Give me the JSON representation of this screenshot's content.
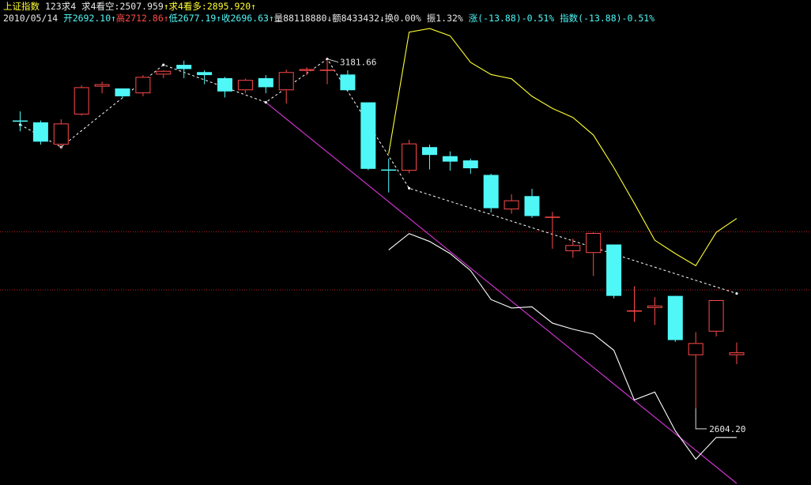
{
  "header": {
    "index_name": "上证指数",
    "mode": "123求4",
    "bear_label": "求4看空",
    "bear_value": "2507.959",
    "bull_label": "求4看多",
    "bull_value": "2895.920",
    "up_arrow": "↑",
    "down_arrow": "↓",
    "date": "2010/05/14",
    "open_label": "开",
    "open_value": "2692.10",
    "high_label": "高",
    "high_value": "2712.86",
    "low_label": "低",
    "low_value": "2677.19",
    "close_label": "收",
    "close_value": "2696.63",
    "volume_label": "量",
    "volume_value": "88118880",
    "amount_label": "额",
    "amount_value": "8433432",
    "turnover_label": "换",
    "turnover_value": "0.00%",
    "amplitude_label": "振",
    "amplitude_value": "1.32%",
    "change_label": "涨",
    "change_value": "(-13.88)-0.51%",
    "index_change_label": "指数",
    "index_change_value": "(-13.88)-0.51%"
  },
  "colors": {
    "background": "#000000",
    "up_candle": "#ff4a4a",
    "down_candle": "#4ff7f7",
    "upper_band": "#ffff33",
    "lower_band": "#ffffff",
    "trend_line": "#cc33cc",
    "zigzag": "#ffffff",
    "ref_line": "#b81e1e"
  },
  "chart_data": {
    "type": "candlestick",
    "annotations": [
      {
        "text": "3181.66",
        "kind": "peak",
        "value": 3181.66
      },
      {
        "text": "2604.20",
        "kind": "trough",
        "value": 2604.2
      }
    ],
    "reference_lines": [
      2895.92,
      2800.0
    ],
    "ylim": [
      2480,
      3240
    ],
    "candles": [
      {
        "o": 3080,
        "h": 3095,
        "l": 3062,
        "c": 3078
      },
      {
        "o": 3077,
        "h": 3080,
        "l": 3040,
        "c": 3045
      },
      {
        "o": 3040,
        "h": 3082,
        "l": 3033,
        "c": 3075
      },
      {
        "o": 3090,
        "h": 3138,
        "l": 3088,
        "c": 3135
      },
      {
        "o": 3136,
        "h": 3144,
        "l": 3125,
        "c": 3140
      },
      {
        "o": 3133,
        "h": 3133,
        "l": 3117,
        "c": 3120
      },
      {
        "o": 3125,
        "h": 3155,
        "l": 3120,
        "c": 3152
      },
      {
        "o": 3156,
        "h": 3163,
        "l": 3150,
        "c": 3162
      },
      {
        "o": 3172,
        "h": 3179,
        "l": 3150,
        "c": 3165
      },
      {
        "o": 3160,
        "h": 3163,
        "l": 3140,
        "c": 3155
      },
      {
        "o": 3150,
        "h": 3152,
        "l": 3118,
        "c": 3128
      },
      {
        "o": 3130,
        "h": 3149,
        "l": 3125,
        "c": 3147
      },
      {
        "o": 3150,
        "h": 3155,
        "l": 3125,
        "c": 3135
      },
      {
        "o": 3130,
        "h": 3164,
        "l": 3108,
        "c": 3160
      },
      {
        "o": 3162,
        "h": 3168,
        "l": 3155,
        "c": 3165
      },
      {
        "o": 3163,
        "h": 3181.66,
        "l": 3140,
        "c": 3164
      },
      {
        "o": 3156,
        "h": 3163,
        "l": 3128,
        "c": 3130
      },
      {
        "o": 3110,
        "h": 3110,
        "l": 2998,
        "c": 3000
      },
      {
        "o": 2999,
        "h": 3017,
        "l": 2961,
        "c": 2997
      },
      {
        "o": 2997,
        "h": 3048,
        "l": 2993,
        "c": 3042
      },
      {
        "o": 3036,
        "h": 3040,
        "l": 2999,
        "c": 3023
      },
      {
        "o": 3021,
        "h": 3029,
        "l": 2997,
        "c": 3012
      },
      {
        "o": 3014,
        "h": 3017,
        "l": 2992,
        "c": 3001
      },
      {
        "o": 2990,
        "h": 2992,
        "l": 2928,
        "c": 2935
      },
      {
        "o": 2933,
        "h": 2958,
        "l": 2926,
        "c": 2948
      },
      {
        "o": 2955,
        "h": 2967,
        "l": 2919,
        "c": 2922
      },
      {
        "o": 2920,
        "h": 2929,
        "l": 2868,
        "c": 2921
      },
      {
        "o": 2864,
        "h": 2885,
        "l": 2853,
        "c": 2874
      },
      {
        "o": 2861,
        "h": 2895,
        "l": 2823,
        "c": 2894
      },
      {
        "o": 2875,
        "h": 2875,
        "l": 2786,
        "c": 2790
      },
      {
        "o": 2765,
        "h": 2806,
        "l": 2747,
        "c": 2766
      },
      {
        "o": 2770,
        "h": 2788,
        "l": 2742,
        "c": 2774
      },
      {
        "o": 2790,
        "h": 2790,
        "l": 2714,
        "c": 2717
      },
      {
        "o": 2692,
        "h": 2730,
        "l": 2604.2,
        "c": 2712
      },
      {
        "o": 2731,
        "h": 2783,
        "l": 2723,
        "c": 2783
      },
      {
        "o": 2692.1,
        "h": 2712.86,
        "l": 2677.19,
        "c": 2696.63
      }
    ],
    "upper_band": [
      null,
      null,
      null,
      null,
      null,
      null,
      null,
      null,
      null,
      null,
      null,
      null,
      null,
      null,
      null,
      null,
      null,
      null,
      3025,
      3226,
      3232,
      3220,
      3176,
      3156,
      3149,
      3120,
      3100,
      3085,
      3056,
      3002,
      2943,
      2882,
      2860,
      2840,
      2895,
      2918
    ],
    "lower_band": [
      null,
      null,
      null,
      null,
      null,
      null,
      null,
      null,
      null,
      null,
      null,
      null,
      null,
      null,
      null,
      null,
      null,
      null,
      2866,
      2893,
      2880,
      2860,
      2832,
      2784,
      2770,
      2772,
      2745,
      2735,
      2727,
      2700,
      2618,
      2631,
      2567,
      2520,
      2556,
      2556
    ],
    "zigzag": [
      3073,
      null,
      3036,
      null,
      null,
      null,
      null,
      3172,
      null,
      null,
      null,
      null,
      3110,
      null,
      null,
      3181.66,
      null,
      null,
      null,
      2968
    ],
    "zigzag_tail_to": 2794,
    "trend_line": {
      "from_index": 12,
      "from_value": 3110,
      "to_index": 35,
      "to_value": 2480
    }
  }
}
